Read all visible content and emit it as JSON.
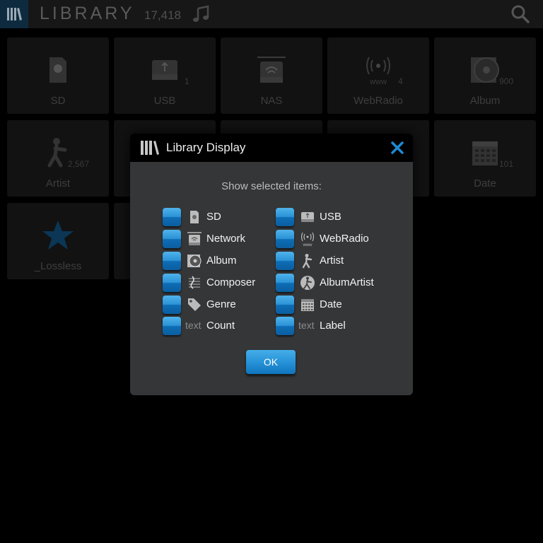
{
  "header": {
    "title": "LIBRARY",
    "count": "17,418"
  },
  "tiles": [
    {
      "label": "SD",
      "count": "",
      "icon": "sd-card-icon"
    },
    {
      "label": "USB",
      "count": "1",
      "icon": "usb-drive-icon"
    },
    {
      "label": "NAS",
      "count": "",
      "icon": "nas-icon"
    },
    {
      "label": "WebRadio",
      "count": "4",
      "icon": "webradio-icon"
    },
    {
      "label": "Album",
      "count": "900",
      "icon": "album-icon"
    },
    {
      "label": "Artist",
      "count": "2,567",
      "icon": "artist-icon"
    },
    {
      "label": "Date",
      "count": "101",
      "icon": "calendar-icon"
    },
    {
      "label": "_Lossless",
      "count": "",
      "icon": "star-icon"
    }
  ],
  "modal": {
    "title": "Library Display",
    "subtitle": "Show selected items:",
    "ok_label": "OK",
    "options": [
      {
        "label": "SD",
        "prefix": "",
        "icon": "sd-card-icon"
      },
      {
        "label": "USB",
        "prefix": "",
        "icon": "usb-drive-icon"
      },
      {
        "label": "Network",
        "prefix": "",
        "icon": "network-icon"
      },
      {
        "label": "WebRadio",
        "prefix": "",
        "icon": "webradio-icon"
      },
      {
        "label": "Album",
        "prefix": "",
        "icon": "album-icon"
      },
      {
        "label": "Artist",
        "prefix": "",
        "icon": "artist-icon"
      },
      {
        "label": "Composer",
        "prefix": "",
        "icon": "composer-icon"
      },
      {
        "label": "AlbumArtist",
        "prefix": "",
        "icon": "album-artist-icon"
      },
      {
        "label": "Genre",
        "prefix": "",
        "icon": "genre-tag-icon"
      },
      {
        "label": "Date",
        "prefix": "",
        "icon": "calendar-icon"
      },
      {
        "label": "Count",
        "prefix": "text",
        "icon": ""
      },
      {
        "label": "Label",
        "prefix": "text",
        "icon": ""
      }
    ]
  },
  "colors": {
    "accent": "#1e8ad2",
    "modal_bg": "#343638",
    "tile_bg": "#121212"
  }
}
